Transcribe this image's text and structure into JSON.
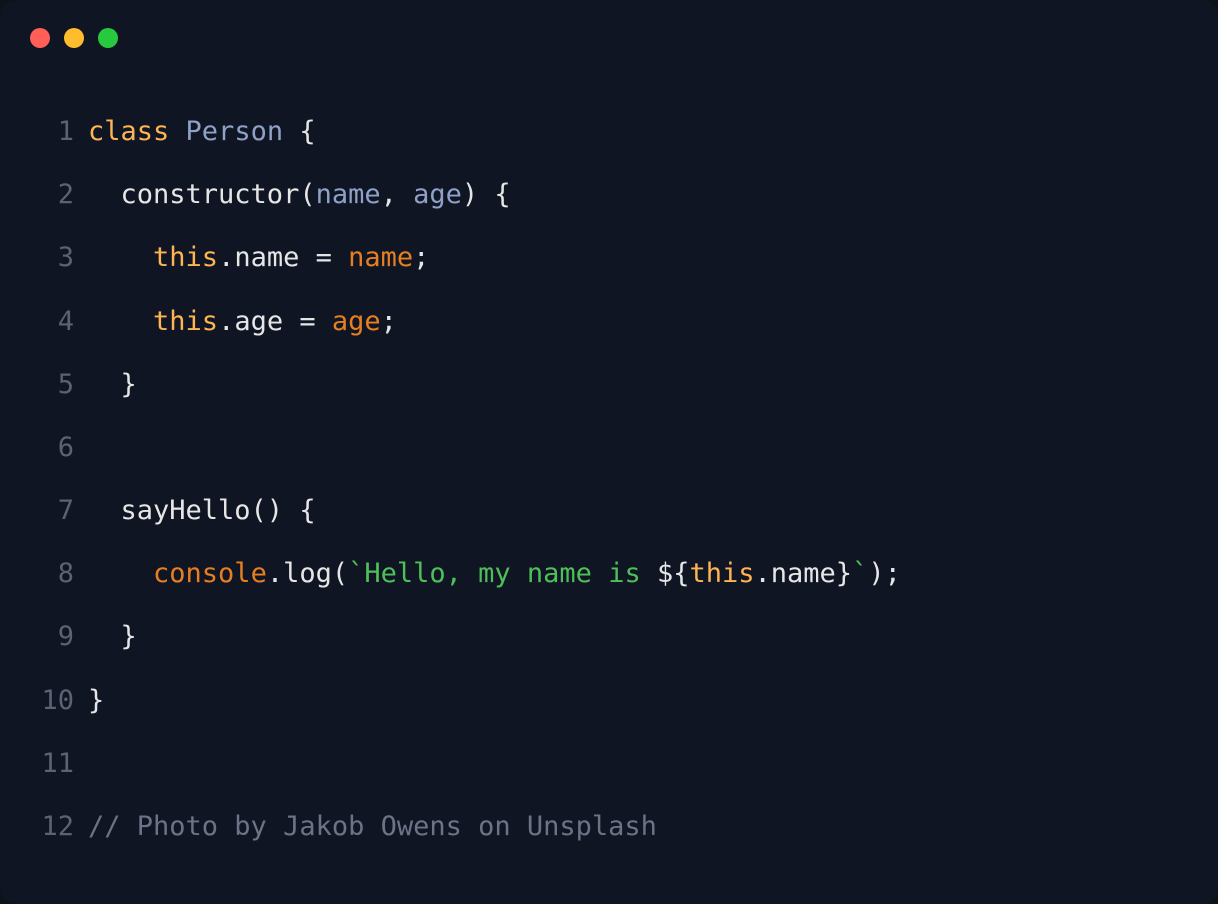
{
  "colors": {
    "background": "#0f1523",
    "lineNumber": "#5b6273",
    "keyword": "#ffb454",
    "type": "#8fa1c7",
    "default": "#e6e6e6",
    "argOrange": "#e67e22",
    "stringGreen": "#4fbf5a",
    "comment": "#6c7386",
    "trafficRed": "#ff5f56",
    "trafficYellow": "#ffbd2e",
    "trafficGreen": "#27c93f"
  },
  "traffic": [
    "red",
    "yellow",
    "green"
  ],
  "lines": [
    {
      "n": "1",
      "tokens": [
        {
          "c": "tok-kw",
          "t": "class"
        },
        {
          "c": "tok-id",
          "t": " "
        },
        {
          "c": "tok-type",
          "t": "Person"
        },
        {
          "c": "tok-id",
          "t": " {"
        }
      ]
    },
    {
      "n": "2",
      "tokens": [
        {
          "c": "tok-id",
          "t": "  constructor("
        },
        {
          "c": "tok-type",
          "t": "name"
        },
        {
          "c": "tok-id",
          "t": ", "
        },
        {
          "c": "tok-type",
          "t": "age"
        },
        {
          "c": "tok-id",
          "t": ") {"
        }
      ]
    },
    {
      "n": "3",
      "tokens": [
        {
          "c": "tok-id",
          "t": "    "
        },
        {
          "c": "tok-this",
          "t": "this"
        },
        {
          "c": "tok-id",
          "t": ".name = "
        },
        {
          "c": "tok-arg",
          "t": "name"
        },
        {
          "c": "tok-id",
          "t": ";"
        }
      ]
    },
    {
      "n": "4",
      "tokens": [
        {
          "c": "tok-id",
          "t": "    "
        },
        {
          "c": "tok-this",
          "t": "this"
        },
        {
          "c": "tok-id",
          "t": ".age = "
        },
        {
          "c": "tok-arg",
          "t": "age"
        },
        {
          "c": "tok-id",
          "t": ";"
        }
      ]
    },
    {
      "n": "5",
      "tokens": [
        {
          "c": "tok-id",
          "t": "  }"
        }
      ]
    },
    {
      "n": "6",
      "tokens": [
        {
          "c": "tok-id",
          "t": ""
        }
      ]
    },
    {
      "n": "7",
      "tokens": [
        {
          "c": "tok-id",
          "t": "  sayHello() {"
        }
      ]
    },
    {
      "n": "8",
      "tokens": [
        {
          "c": "tok-id",
          "t": "    "
        },
        {
          "c": "tok-console",
          "t": "console"
        },
        {
          "c": "tok-id",
          "t": ".log("
        },
        {
          "c": "tok-str",
          "t": "`Hello, my name is "
        },
        {
          "c": "tok-id",
          "t": "${"
        },
        {
          "c": "tok-this",
          "t": "this"
        },
        {
          "c": "tok-id",
          "t": ".name}"
        },
        {
          "c": "tok-str",
          "t": "`"
        },
        {
          "c": "tok-id",
          "t": ");"
        }
      ]
    },
    {
      "n": "9",
      "tokens": [
        {
          "c": "tok-id",
          "t": "  }"
        }
      ]
    },
    {
      "n": "10",
      "tokens": [
        {
          "c": "tok-id",
          "t": "}"
        }
      ]
    },
    {
      "n": "11",
      "tokens": [
        {
          "c": "tok-id",
          "t": ""
        }
      ]
    },
    {
      "n": "12",
      "tokens": [
        {
          "c": "tok-comment",
          "t": "// Photo by Jakob Owens on Unsplash"
        }
      ]
    }
  ]
}
